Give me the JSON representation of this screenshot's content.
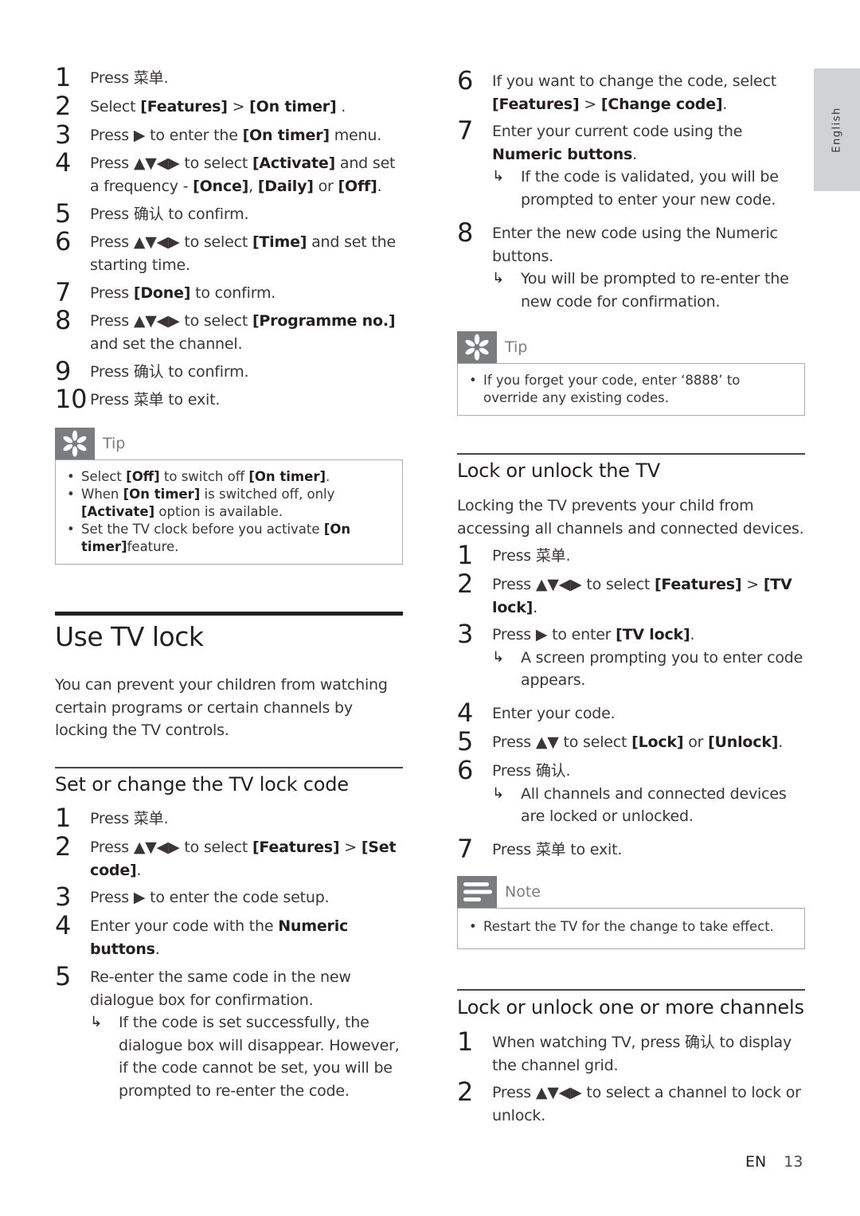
{
  "language_tab": "English",
  "footer": {
    "lang": "EN",
    "page": "13"
  },
  "left": {
    "timer_steps": [
      {
        "n": "1",
        "html": "Press 菜单."
      },
      {
        "n": "2",
        "html": "Select <b>[Features]</b> &gt; <b>[On timer]</b> ."
      },
      {
        "n": "3",
        "html": "Press ▶ to enter the <b>[On timer]</b> menu."
      },
      {
        "n": "4",
        "html": "Press ▲▼◀▶ to select <b>[Activate]</b> and set a frequency - <b>[Once]</b>, <b>[Daily]</b> or <b>[Off]</b>."
      },
      {
        "n": "5",
        "html": "Press 确认 to confirm."
      },
      {
        "n": "6",
        "html": "Press ▲▼◀▶ to select <b>[Time]</b> and set the starting time."
      },
      {
        "n": "7",
        "html": "Press <b>[Done]</b> to confirm."
      },
      {
        "n": "8",
        "html": "Press ▲▼◀▶ to select <b>[Programme no.]</b> and set the channel."
      },
      {
        "n": "9",
        "html": "Press 确认 to confirm."
      },
      {
        "n": "10",
        "html": "Press 菜单 to exit."
      }
    ],
    "tip1": {
      "label": "Tip",
      "icon": "tip-asterisk-icon",
      "items": [
        "Select <b>[Off]</b> to switch off <b>[On timer]</b>.",
        "When <b>[On timer]</b> is switched off, only <b>[Activate]</b> option is available.",
        "Set the TV clock before you activate <b>[On timer]</b>feature."
      ]
    },
    "use_tv_lock": {
      "title": "Use TV lock",
      "intro": "You can prevent your children from watching certain programs or certain channels by locking the TV controls."
    },
    "set_code": {
      "title": "Set or change the TV lock code",
      "steps": [
        {
          "n": "1",
          "html": "Press 菜单."
        },
        {
          "n": "2",
          "html": "Press ▲▼◀▶ to select <b>[Features]</b> &gt; <b>[Set code]</b>."
        },
        {
          "n": "3",
          "html": "Press ▶ to enter the code setup."
        },
        {
          "n": "4",
          "html": "Enter your code with the <b>Numeric buttons</b>."
        },
        {
          "n": "5",
          "html": "Re-enter the same code in the new dialogue box for confirmation.",
          "result": "If the code is set successfully, the dialogue box will disappear. However, if the code cannot be set, you will be prompted to re-enter the code."
        }
      ]
    }
  },
  "right": {
    "change_steps": [
      {
        "n": "6",
        "html": "If you want to change the code, select <b>[Features]</b> &gt; <b>[Change code]</b>."
      },
      {
        "n": "7",
        "html": "Enter your current code using the <b>Numeric buttons</b>.",
        "result": "If the code is validated, you will be prompted to enter your new code."
      },
      {
        "n": "8",
        "html": "Enter the new code using the Numeric buttons.",
        "result": "You will be prompted to re-enter the new code for confirmation."
      }
    ],
    "tip2": {
      "label": "Tip",
      "icon": "tip-asterisk-icon",
      "items": [
        "If you forget your code, enter ‘8888’ to override any existing codes."
      ]
    },
    "lock_tv": {
      "title": "Lock or unlock the TV",
      "intro": "Locking the TV prevents your child from accessing all channels and connected devices.",
      "steps": [
        {
          "n": "1",
          "html": "Press 菜单."
        },
        {
          "n": "2",
          "html": "Press ▲▼◀▶ to select <b>[Features]</b> &gt; <b>[TV lock]</b>."
        },
        {
          "n": "3",
          "html": "Press ▶ to enter <b>[TV lock]</b>.",
          "result": "A screen prompting you to enter code appears."
        },
        {
          "n": "4",
          "html": "Enter your code."
        },
        {
          "n": "5",
          "html": "Press ▲▼ to select <b>[Lock]</b> or <b>[Unlock]</b>."
        },
        {
          "n": "6",
          "html": "Press 确认.",
          "result": "All channels and connected devices are locked or unlocked."
        },
        {
          "n": "7",
          "html": "Press 菜单 to exit."
        }
      ]
    },
    "note": {
      "label": "Note",
      "icon": "note-lines-icon",
      "items": [
        "Restart the TV for the change to take effect."
      ]
    },
    "lock_channels": {
      "title": "Lock or unlock one or more channels",
      "steps": [
        {
          "n": "1",
          "html": "When watching TV, press 确认 to display the channel grid."
        },
        {
          "n": "2",
          "html": "Press ▲▼◀▶ to select a channel to lock or unlock."
        }
      ]
    }
  }
}
